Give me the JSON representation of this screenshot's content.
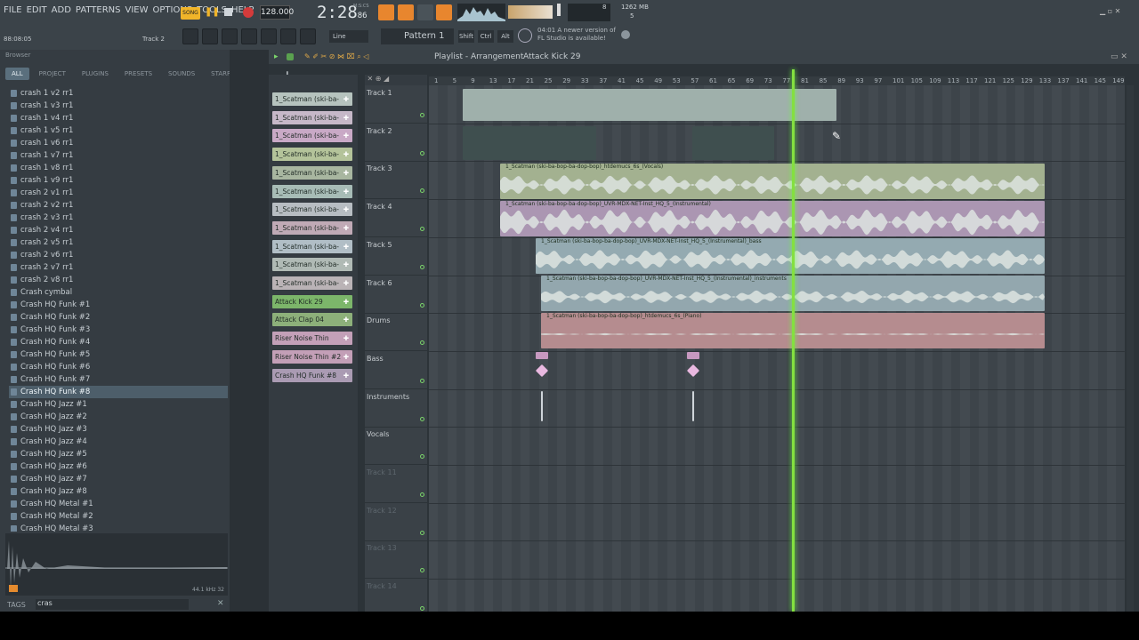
{
  "menu": [
    "FILE",
    "EDIT",
    "ADD",
    "PATTERNS",
    "VIEW",
    "OPTIONS",
    "TOOLS",
    "HELP"
  ],
  "transport": {
    "mode": "SONG",
    "tempo": "128.000",
    "time": "2:28",
    "time_frac": "86",
    "time_unit": "M:S:CS",
    "cpu": "8",
    "mem": "1262 MB",
    "voices": "5",
    "hint_pos": "88:08:05",
    "hint_track": "Track 2"
  },
  "toolbar": {
    "snap": "Line",
    "pattern": "Pattern 1",
    "shift": "Shift",
    "ctrl": "Ctrl",
    "alt": "Alt"
  },
  "news": {
    "time": "04:01",
    "line1": "A newer version of",
    "line2": "FL Studio is available!"
  },
  "browser": {
    "title": "Browser",
    "tabs": [
      "ALL",
      "PROJECT",
      "PLUGINS",
      "PRESETS",
      "SOUNDS",
      "STARRED"
    ],
    "items": [
      "crash 1 v2 rr1",
      "crash 1 v3 rr1",
      "crash 1 v4 rr1",
      "crash 1 v5 rr1",
      "crash 1 v6 rr1",
      "crash 1 v7 rr1",
      "crash 1 v8 rr1",
      "crash 1 v9 rr1",
      "crash 2 v1 rr1",
      "crash 2 v2 rr1",
      "crash 2 v3 rr1",
      "crash 2 v4 rr1",
      "crash 2 v5 rr1",
      "crash 2 v6 rr1",
      "crash 2 v7 rr1",
      "crash 2 v8 rr1",
      "Crash cymbal",
      "Crash HQ Funk #1",
      "Crash HQ Funk #2",
      "Crash HQ Funk #3",
      "Crash HQ Funk #4",
      "Crash HQ Funk #5",
      "Crash HQ Funk #6",
      "Crash HQ Funk #7",
      "Crash HQ Funk #8",
      "Crash HQ Jazz #1",
      "Crash HQ Jazz #2",
      "Crash HQ Jazz #3",
      "Crash HQ Jazz #4",
      "Crash HQ Jazz #5",
      "Crash HQ Jazz #6",
      "Crash HQ Jazz #7",
      "Crash HQ Jazz #8",
      "Crash HQ Metal #1",
      "Crash HQ Metal #2",
      "Crash HQ Metal #3"
    ],
    "selected": "Crash HQ Funk #8",
    "sample_info": "44.1 kHz 32",
    "tags_label": "TAGS",
    "search": "cras"
  },
  "playlist": {
    "title": "Playlist - Arrangement",
    "pattern": "Attack Kick 29",
    "picker": [
      {
        "label": "1_Scatman (ski-ba-",
        "color": "#b6c3be"
      },
      {
        "label": "1_Scatman (ski-ba-",
        "color": "#c6b8c8"
      },
      {
        "label": "1_Scatman (ski-ba-",
        "color": "#c9a9c6"
      },
      {
        "label": "1_Scatman (ski-ba-",
        "color": "#b4c39a"
      },
      {
        "label": "1_Scatman (ski-ba-",
        "color": "#a8b6a0"
      },
      {
        "label": "1_Scatman (ski-ba-",
        "color": "#a7bcb6"
      },
      {
        "label": "1_Scatman (ski-ba-",
        "color": "#b7bdc2"
      },
      {
        "label": "1_Scatman (ski-ba-",
        "color": "#c0aab6"
      },
      {
        "label": "1_Scatman (ski-ba-",
        "color": "#b1bec6"
      },
      {
        "label": "1_Scatman (ski-ba-",
        "color": "#b0bab5"
      },
      {
        "label": "1_Scatman (ski-ba-",
        "color": "#bab3b6"
      },
      {
        "label": "Attack Kick 29",
        "color": "#7cb66a"
      },
      {
        "label": "Attack Clap 04",
        "color": "#8db07a"
      },
      {
        "label": "Riser Noise Thin",
        "color": "#c3a0b8"
      },
      {
        "label": "Riser Noise Thin #2",
        "color": "#c39fb7"
      },
      {
        "label": "Crash HQ Funk #8",
        "color": "#aa9bb3"
      }
    ],
    "tracks": [
      "Track 1",
      "Track 2",
      "Track 3",
      "Track 4",
      "Track 5",
      "Track 6",
      "Drums",
      "Bass",
      "Instruments",
      "Vocals",
      "Track 11",
      "Track 12",
      "Track 13",
      "Track 14"
    ],
    "ruler": [
      "1",
      "5",
      "9",
      "13",
      "17",
      "21",
      "25",
      "29",
      "33",
      "37",
      "41",
      "45",
      "49",
      "53",
      "57",
      "61",
      "65",
      "69",
      "73",
      "77",
      "81",
      "85",
      "89",
      "93",
      "97",
      "101",
      "105",
      "109",
      "113",
      "117",
      "121",
      "125",
      "129",
      "133",
      "137",
      "141",
      "145",
      "149"
    ],
    "clip_labels": [
      "1_Scatman (ski-ba-bop-ba-dop-bop)_htdemucs_6s_(Vocals)",
      "1_Scatman (ski-ba-bop-ba-dop-bop)_UVR-MDX-NET-Inst_HQ_5_(Instrumental)",
      "1_Scatman (ski-ba-bop-ba-dop-bop)_UVR-MDX-NET-Inst_HQ_5_(Instrumental)_bass",
      "1_Scatman (ski-ba-bop-ba-dop-bop)_UVR-MDX-NET-Inst_HQ_5_(Instrumental)_instruments",
      "1_Scatman (ski-ba-bop-ba-dop-bop)_htdemucs_6s_(Piano)"
    ]
  }
}
